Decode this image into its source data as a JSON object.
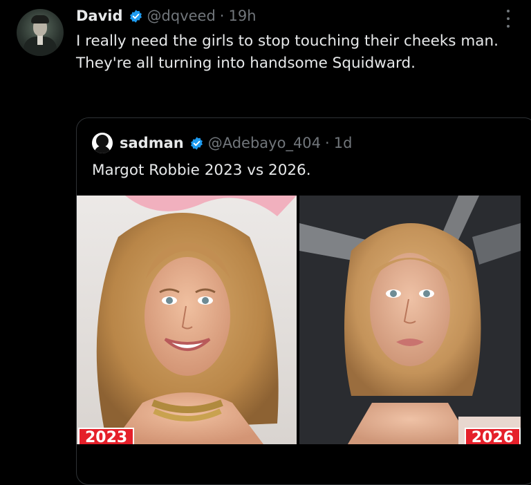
{
  "tweet": {
    "author_name": "David",
    "handle": "@dqveed",
    "separator": "·",
    "time": "19h",
    "text": "I really need the girls to stop touching their cheeks man. They're all turning into handsome Squidward."
  },
  "quoted": {
    "author_name": "sadman",
    "handle": "@Adebayo_404",
    "separator": "·",
    "time": "1d",
    "text": "Margot Robbie 2023 vs 2026.",
    "images": [
      {
        "badge": "2023"
      },
      {
        "badge": "2026"
      }
    ]
  },
  "colors": {
    "background": "#000000",
    "text": "#e7e9ea",
    "muted": "#71767b",
    "verified": "#1d9bf0",
    "border": "#2f3336",
    "badge": "#e5202a"
  },
  "icons": {
    "verified": "verified-badge-icon",
    "more": "more-options-icon"
  }
}
